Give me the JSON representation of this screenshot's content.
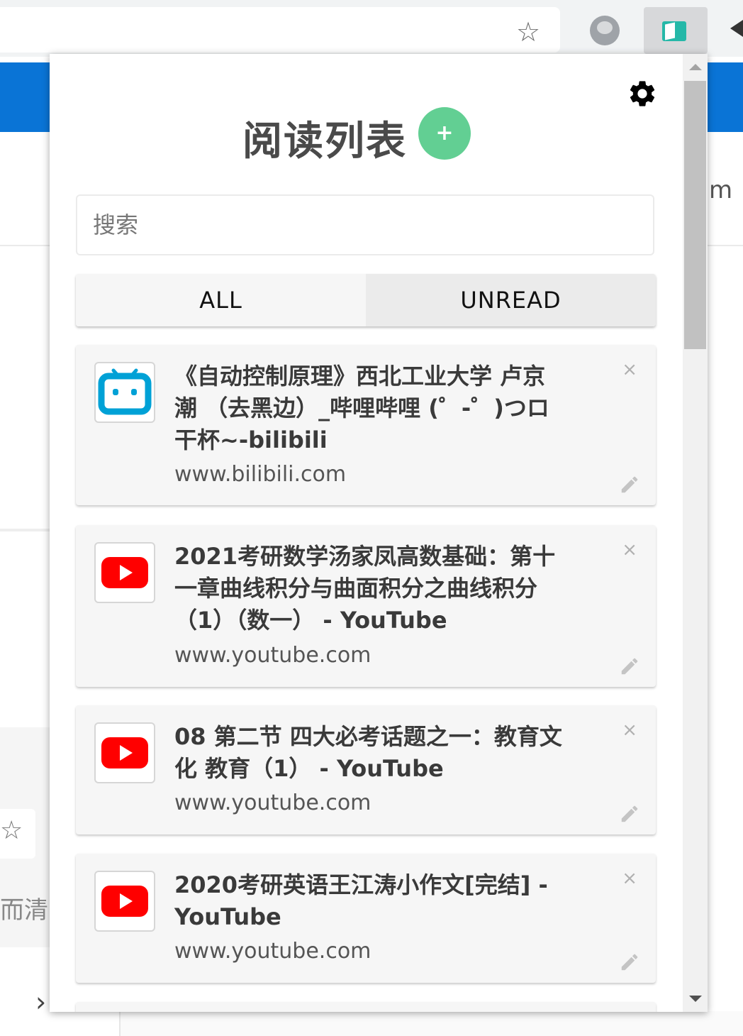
{
  "browser": {
    "star_icon": "☆",
    "background_fragments": {
      "right_text": "m",
      "left_text": "而清",
      "chevron": "›"
    }
  },
  "popup": {
    "title": "阅读列表",
    "add_label": "+",
    "search": {
      "placeholder": "搜索",
      "value": ""
    },
    "tabs": [
      {
        "label": "ALL"
      },
      {
        "label": "UNREAD"
      }
    ],
    "items": [
      {
        "title": "《自动控制原理》西北工业大学 卢京潮 （去黑边）_哔哩哔哩 (゜-゜)つロ 干杯~-bilibili",
        "url": "www.bilibili.com",
        "favicon": "bilibili-icon"
      },
      {
        "title": "2021考研数学汤家凤高数基础：第十一章曲线积分与曲面积分之曲线积分（1）（数一） - YouTube",
        "url": "www.youtube.com",
        "favicon": "youtube-icon"
      },
      {
        "title": "08 第二节 四大必考话题之一：教育文化 教育（1） - YouTube",
        "url": "www.youtube.com",
        "favicon": "youtube-icon"
      },
      {
        "title": "2020考研英语王江涛小作文[完结] - YouTube",
        "url": "www.youtube.com",
        "favicon": "youtube-icon"
      }
    ],
    "close_symbol": "×"
  },
  "colors": {
    "add_button": "#62cf93",
    "brand_blue": "#0a74d6",
    "youtube_red": "#ff0000",
    "bilibili_blue": "#00a1d6"
  }
}
